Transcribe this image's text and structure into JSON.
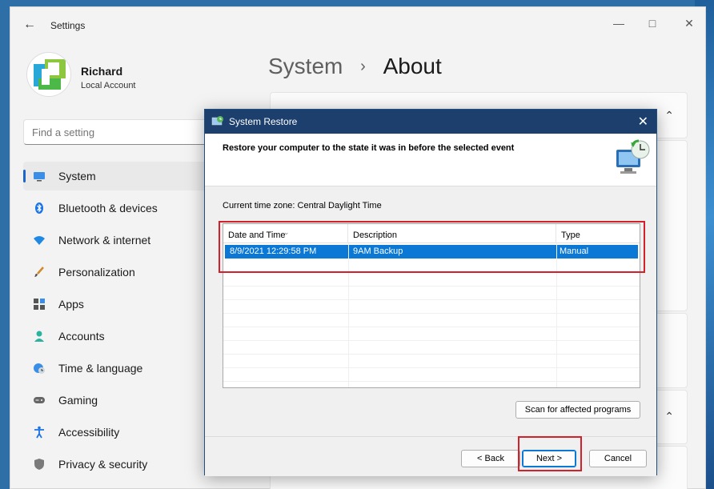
{
  "settings": {
    "title": "Settings",
    "profile": {
      "name": "Richard",
      "account_type": "Local Account"
    },
    "search_placeholder": "Find a setting",
    "nav": [
      {
        "label": "System",
        "icon": "monitor-icon",
        "active": true
      },
      {
        "label": "Bluetooth & devices",
        "icon": "bluetooth-icon"
      },
      {
        "label": "Network & internet",
        "icon": "wifi-icon"
      },
      {
        "label": "Personalization",
        "icon": "brush-icon"
      },
      {
        "label": "Apps",
        "icon": "apps-icon"
      },
      {
        "label": "Accounts",
        "icon": "person-icon"
      },
      {
        "label": "Time & language",
        "icon": "globe-clock-icon"
      },
      {
        "label": "Gaming",
        "icon": "gamepad-icon"
      },
      {
        "label": "Accessibility",
        "icon": "accessibility-icon"
      },
      {
        "label": "Privacy & security",
        "icon": "shield-icon"
      }
    ],
    "breadcrumb": {
      "parent": "System",
      "separator": "›",
      "current": "About"
    }
  },
  "dialog": {
    "title": "System Restore",
    "heading": "Restore your computer to the state it was in before the selected event",
    "timezone": "Current time zone: Central Daylight Time",
    "columns": [
      "Date and Time",
      "Description",
      "Type"
    ],
    "rows": [
      {
        "date": "8/9/2021 12:29:58 PM",
        "description": "9AM Backup",
        "type": "Manual",
        "selected": true
      }
    ],
    "scan_button": "Scan for affected programs",
    "back_button": "< Back",
    "next_button": "Next >",
    "cancel_button": "Cancel"
  },
  "colors": {
    "accent": "#0a78d4",
    "dialog_titlebar": "#1c3f6e",
    "highlight": "#d4202a"
  }
}
